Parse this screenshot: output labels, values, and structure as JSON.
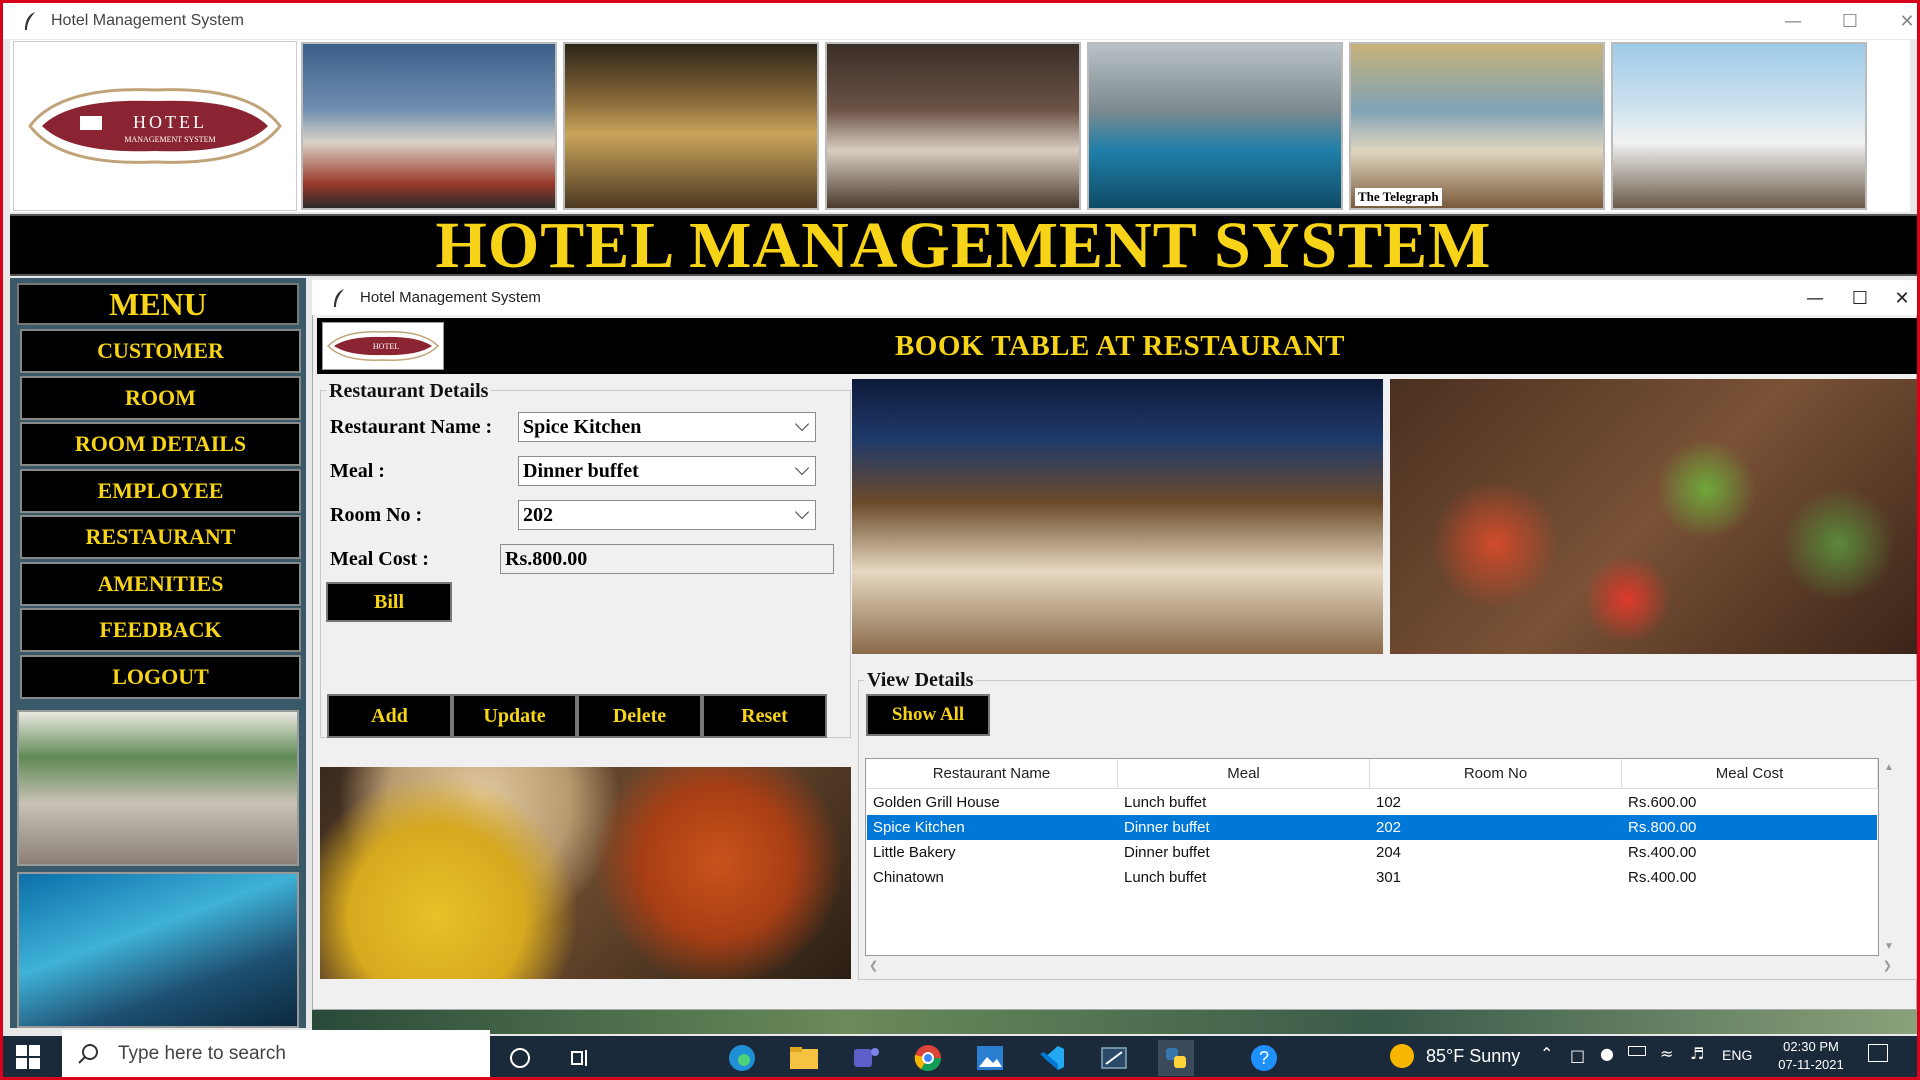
{
  "window": {
    "title": "Hotel Management System"
  },
  "logo": {
    "line1": "HOTEL",
    "line2": "MANAGEMENT SYSTEM"
  },
  "banner": {
    "title": "HOTEL MANAGEMENT SYSTEM",
    "telegraph": "The Telegraph"
  },
  "menu": {
    "heading": "MENU",
    "items": [
      {
        "label": "CUSTOMER"
      },
      {
        "label": "ROOM"
      },
      {
        "label": "ROOM DETAILS"
      },
      {
        "label": "EMPLOYEE"
      },
      {
        "label": "RESTAURANT"
      },
      {
        "label": "AMENITIES"
      },
      {
        "label": "FEEDBACK"
      },
      {
        "label": "LOGOUT"
      }
    ]
  },
  "dialog": {
    "title": "Hotel Management System",
    "heading": "BOOK TABLE AT RESTAURANT",
    "logo_text": "HOTEL",
    "details_legend": "Restaurant Details",
    "fields": {
      "restaurant_label": "Restaurant Name :",
      "restaurant_value": "Spice Kitchen",
      "meal_label": "Meal :",
      "meal_value": "Dinner buffet",
      "room_label": "Room No :",
      "room_value": "202",
      "cost_label": "Meal Cost :",
      "cost_value": "Rs.800.00"
    },
    "buttons": {
      "bill": "Bill",
      "add": "Add",
      "update": "Update",
      "delete": "Delete",
      "reset": "Reset",
      "show_all": "Show All"
    },
    "view_legend": "View Details",
    "table": {
      "columns": [
        "Restaurant Name",
        "Meal",
        "Room No",
        "Meal Cost"
      ],
      "rows": [
        [
          "Golden Grill House",
          "Lunch buffet",
          "102",
          "Rs.600.00"
        ],
        [
          "Spice Kitchen",
          "Dinner buffet",
          "202",
          "Rs.800.00"
        ],
        [
          "Little Bakery",
          "Dinner buffet",
          "204",
          "Rs.400.00"
        ],
        [
          "Chinatown",
          "Lunch buffet",
          "301",
          "Rs.400.00"
        ]
      ],
      "selected_row": 1
    }
  },
  "taskbar": {
    "search_placeholder": "Type here to search",
    "weather": "85°F  Sunny",
    "lang": "ENG",
    "time": "02:30 PM",
    "date": "07-11-2021"
  },
  "colors": {
    "accent_yellow": "#f7d417",
    "selection_blue": "#0078d7",
    "logo_maroon": "#8b2432",
    "frame_red": "#d9001b"
  }
}
